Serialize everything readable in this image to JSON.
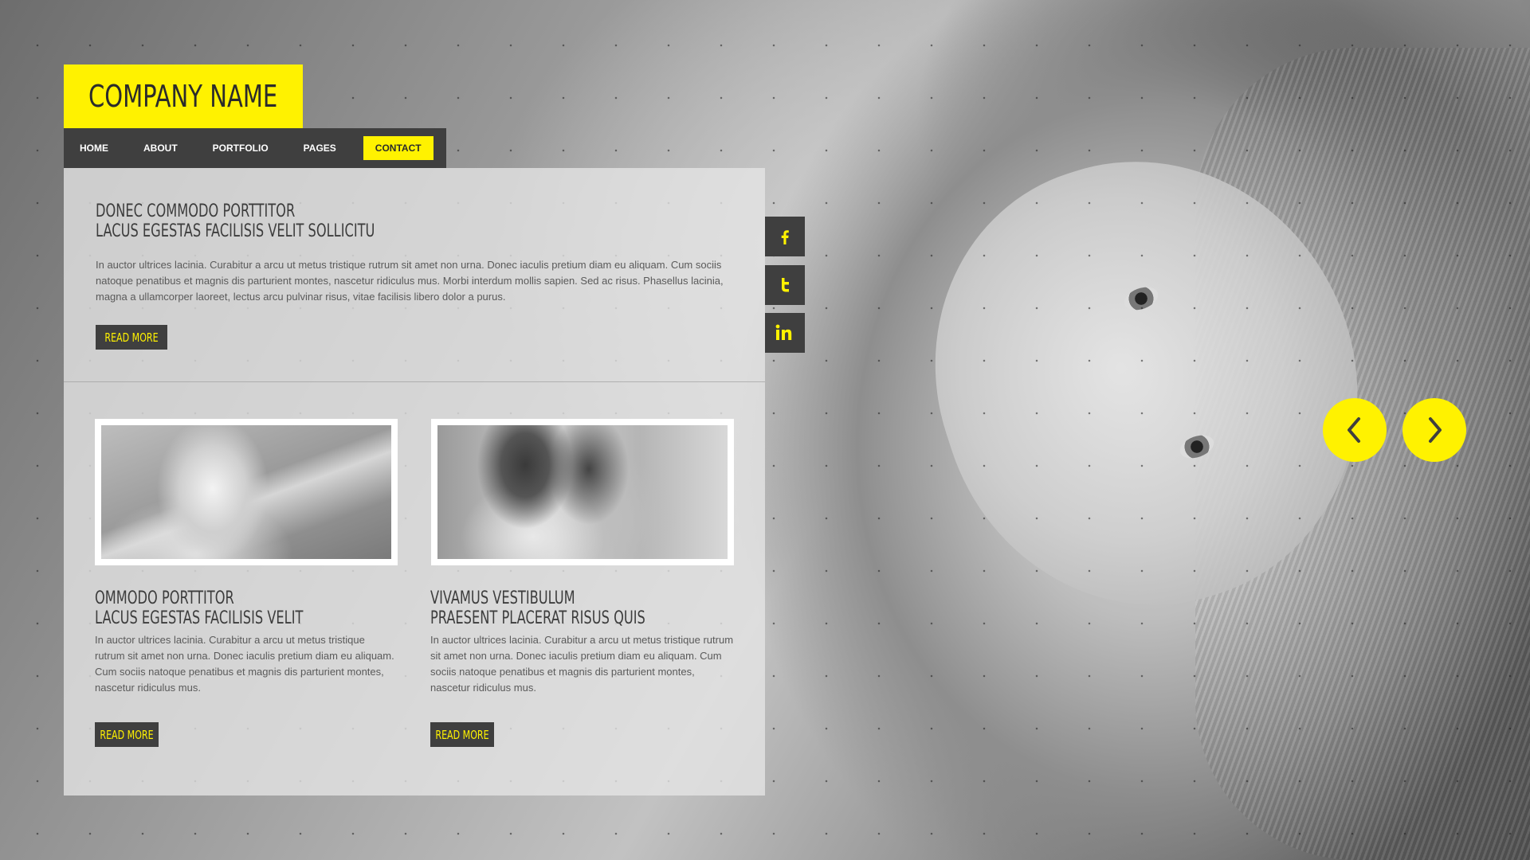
{
  "brand": {
    "name": "COMPANY NAME"
  },
  "nav": {
    "items": [
      {
        "label": "HOME"
      },
      {
        "label": "ABOUT"
      },
      {
        "label": "PORTFOLIO"
      },
      {
        "label": "PAGES"
      },
      {
        "label": "CONTACT",
        "active": true
      }
    ]
  },
  "featured": {
    "title_line1": "DONEC COMMODO PORTTITOR",
    "title_line2": "LACUS EGESTAS FACILISIS VELIT SOLLICITU",
    "body": "In auctor ultrices lacinia. Curabitur a arcu ut metus tristique rutrum sit amet non urna. Donec iaculis pretium diam eu aliquam. Cum sociis natoque penatibus et magnis dis parturient montes, nascetur ridiculus mus. Morbi interdum mollis sapien. Sed ac risus. Phasellus lacinia, magna a ullamcorper laoreet, lectus arcu pulvinar risus, vitae facilisis libero dolor a purus.",
    "button": "READ MORE"
  },
  "cards": [
    {
      "title_line1": "OMMODO PORTTITOR",
      "title_line2": "LACUS EGESTAS FACILISIS VELIT",
      "body": "In auctor ultrices lacinia. Curabitur a arcu ut metus tristique rutrum sit amet non urna. Donec iaculis pretium diam eu aliquam. Cum sociis natoque penatibus et magnis dis parturient montes, nascetur ridiculus mus.",
      "button": "READ MORE"
    },
    {
      "title_line1": "VIVAMUS VESTIBULUM",
      "title_line2": "PRAESENT PLACERAT RISUS QUIS",
      "body": "In auctor ultrices lacinia. Curabitur a arcu ut metus tristique rutrum sit amet non urna. Donec iaculis pretium diam eu aliquam. Cum sociis natoque penatibus et magnis dis parturient montes, nascetur ridiculus mus.",
      "button": "READ MORE"
    }
  ],
  "social": [
    {
      "icon": "facebook-icon",
      "glyph": "f"
    },
    {
      "icon": "twitter-icon",
      "glyph": "t"
    },
    {
      "icon": "linkedin-icon",
      "glyph": "in"
    }
  ],
  "slider": {
    "prev_icon": "chevron-left-icon",
    "next_icon": "chevron-right-icon"
  },
  "colors": {
    "accent": "#fff200",
    "dark": "#3f3f3f",
    "text": "#5a5a5a"
  }
}
